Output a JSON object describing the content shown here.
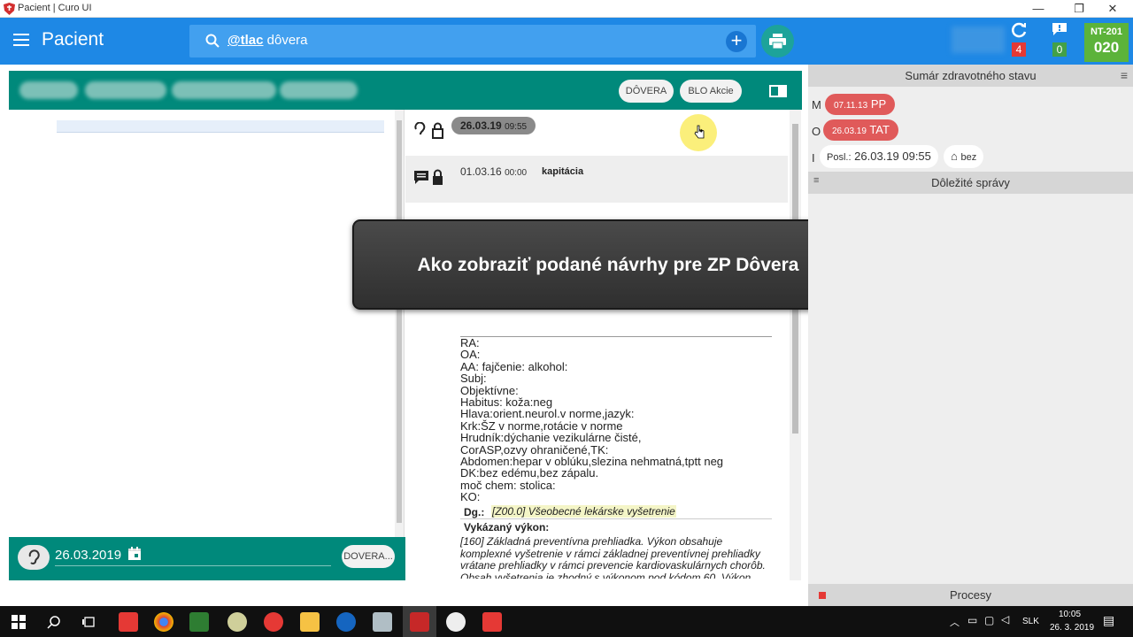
{
  "window": {
    "title": "Pacient | Curo UI",
    "minimize": "—",
    "maximize": "❐",
    "close": "✕"
  },
  "appbar": {
    "title": "Pacient",
    "search": {
      "query_prefix": "@tlac",
      "query_rest": "dôvera"
    },
    "add_label": "+",
    "sync_count": "4",
    "message_count": "0",
    "nt_label": "NT-201",
    "nt_number": "020"
  },
  "toolbar": {
    "dovera_btn": "DÔVERA",
    "blo_btn": "BLO Akcie"
  },
  "records": [
    {
      "date": "26.03.19",
      "time": "09:55"
    },
    {
      "date": "01.03.16",
      "time": "00:00",
      "type": "kapitácia"
    }
  ],
  "record_text": "RA:\nOA:\nAA: fajčenie: alkohol:\nSubj:\nObjektívne:\nHabitus: koža:neg\nHlava:orient.neurol.v norme,jazyk:\nKrk:ŠZ v norme,rotácie v norme\nHrudník:dýchanie vezikulárne čisté,\nCorASP,ozvy ohraničené,TK:\nAbdomen:hepar v oblúku,slezina nehmatná,tptt neg\nDK:bez edému,bez zápalu.\nmoč chem: stolica:\nKO:",
  "diagnosis": {
    "label": "Dg.:",
    "value": "[Z00.0] Všeobecné lekárske vyšetrenie"
  },
  "procedure": {
    "label": "Vykázaný výkon:",
    "text": "[160] Základná preventívna prehliadka. Výkon obsahuje komplexné vyšetrenie v rámci základnej preventívnej prehliadky vrátane prehliadky v rámci prevencie kardiovaskulárnych chorôb. Obsah vyšetrenia je zhodný s výkonom pod kódom 60. Výkon"
  },
  "date_bar": {
    "date": "26.03.2019",
    "button": "DOVERA..."
  },
  "overlay": {
    "text": "Ako zobraziť podané návrhy pre ZP Dôvera"
  },
  "summary": {
    "title": "Sumár zdravotného stavu",
    "rows": [
      {
        "letter": "M",
        "date": "07.11.13",
        "code": "PP"
      },
      {
        "letter": "O",
        "date": "26.03.19",
        "code": "TAT"
      }
    ],
    "last_letter": "I",
    "last_label": "Posl.:",
    "last_value": "26.03.19 09:55",
    "attach_label": "bez"
  },
  "important_messages": "Dôležité správy",
  "processes": "Procesy",
  "taskbar": {
    "language": "SLK",
    "time": "10:05",
    "date": "26. 3. 2019"
  },
  "colors": {
    "appbar": "#1e88e5",
    "teal": "#00897b",
    "red_chip": "#e05a5a",
    "green_badge": "#5cb33a"
  }
}
